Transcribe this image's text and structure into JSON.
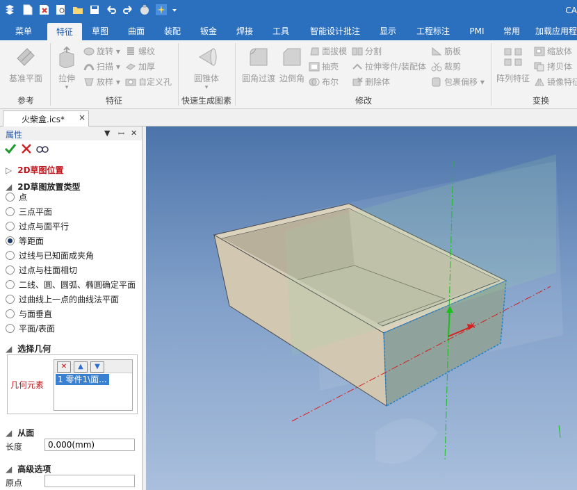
{
  "window": {
    "app_title": "CA"
  },
  "menu_tabs": [
    "菜单",
    "特征",
    "草图",
    "曲面",
    "装配",
    "钣金",
    "焊接",
    "工具",
    "智能设计批注",
    "显示",
    "工程标注",
    "PMI",
    "常用",
    "加载应用程"
  ],
  "active_tab": "特征",
  "ribbon": {
    "groups": {
      "reference": "参考",
      "feature": "特征",
      "quick": "快速生成图素",
      "modify": "修改",
      "transform": "变换"
    },
    "buttons": {
      "datum_plane": "基准平面",
      "extrude": "拉伸",
      "revolve": "旋转",
      "sweep": "扫描",
      "loft": "放样",
      "helix": "螺纹",
      "thicken": "加厚",
      "custom_hole": "自定义孔",
      "cone": "圆锥体",
      "fillet": "圆角过渡",
      "chamfer": "边倒角",
      "draft": "面拔模",
      "shell": "抽壳",
      "boolean": "布尔",
      "split": "分割",
      "extrude_part": "拉伸零件/装配体",
      "delete_body": "删除体",
      "rib": "筋板",
      "trim": "裁剪",
      "wrap_offset": "包裹偏移",
      "pattern": "阵列特征",
      "scale": "缩放体",
      "copy": "拷贝体",
      "mirror": "镜像特征"
    }
  },
  "document_tab": {
    "title": "火柴盒.ics*",
    "close": "×"
  },
  "panel": {
    "title": "属性",
    "section_position": "2D草图位置",
    "section_type": "2D草图放置类型",
    "options": [
      "点",
      "三点平面",
      "过点与面平行",
      "等距面",
      "过线与已知面成夹角",
      "过点与柱面相切",
      "二线、圆、圆弧、椭圆确定平面",
      "过曲线上一点的曲线法平面",
      "与面垂直",
      "平面/表面"
    ],
    "selected_option": "等距面",
    "section_geometry": "选择几何",
    "geometry_label": "几何元素",
    "geometry_item": "1   零件1\\面...",
    "section_from": "从面",
    "length_label": "长度",
    "length_value": "0.000(mm)",
    "section_advanced": "高级选项",
    "origin_label": "原点",
    "origin_value": ""
  },
  "colors": {
    "titlebar": "#2b6fbf",
    "selection": "#3a80d0",
    "box_face": "#d7cdb8"
  }
}
